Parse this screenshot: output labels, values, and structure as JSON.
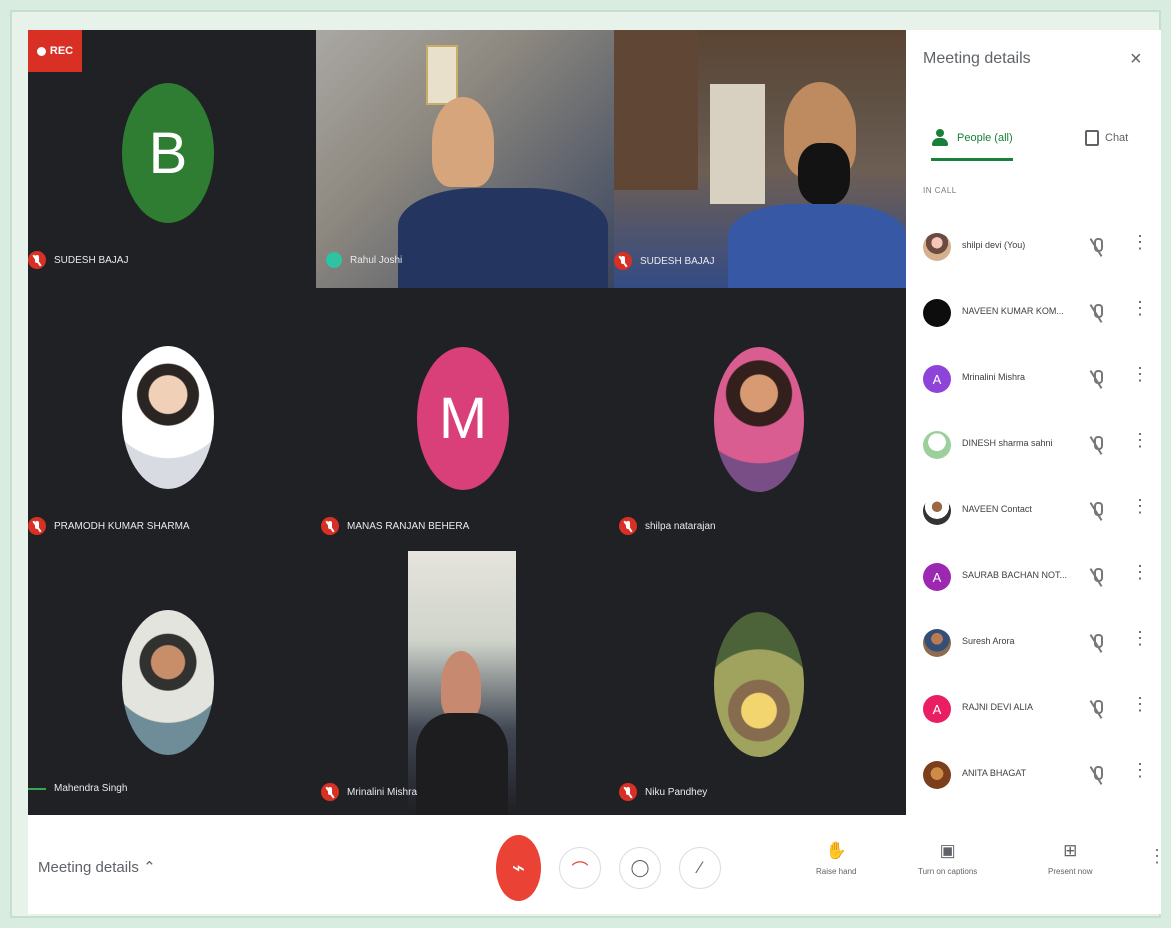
{
  "recording": {
    "label": "REC"
  },
  "tiles": [
    {
      "name": "SUDESH BAJAJ",
      "avatar_letter": "B",
      "avatar_color": "#2e7d32"
    },
    {
      "name": "Rahul Joshi"
    },
    {
      "name": "SUDESH BAJAJ"
    },
    {
      "name": "PRAMODH KUMAR SHARMA"
    },
    {
      "name": "MANAS RANJAN BEHERA",
      "avatar_letter": "M",
      "avatar_color": "#d93f78"
    },
    {
      "name": "shilpa natarajan"
    },
    {
      "name": "Mahendra Singh"
    },
    {
      "name": "Mrinalini Mishra"
    },
    {
      "name": "Niku Pandhey"
    }
  ],
  "side_panel": {
    "title": "Meeting details",
    "tabs": {
      "people": "People (all)",
      "chat": "Chat"
    },
    "section_label": "IN CALL",
    "participants": [
      {
        "name": "shilpi devi (You)",
        "avatar_type": "photo"
      },
      {
        "name": "NAVEEN KUMAR KOM...",
        "avatar_type": "photo-dark"
      },
      {
        "name": "Mrinalini Mishra",
        "avatar_letter": "A",
        "avatar_color": "#8e44d8"
      },
      {
        "name": "DINESH sharma sahni",
        "avatar_type": "photo-light"
      },
      {
        "name": "NAVEEN Contact",
        "avatar_type": "photo-light"
      },
      {
        "name": "SAURAB BACHAN NOT...",
        "avatar_letter": "A",
        "avatar_color": "#9c27b0"
      },
      {
        "name": "Suresh Arora",
        "avatar_type": "photo"
      },
      {
        "name": "RAJNI DEVI ALIA",
        "avatar_letter": "A",
        "avatar_color": "#e91e63"
      },
      {
        "name": "ANITA BHAGAT",
        "avatar_type": "photo"
      }
    ]
  },
  "bottom_bar": {
    "meeting_details": "Meeting details",
    "raise_hand": "Raise hand",
    "captions": "Turn on captions",
    "present_now": "Present now"
  }
}
